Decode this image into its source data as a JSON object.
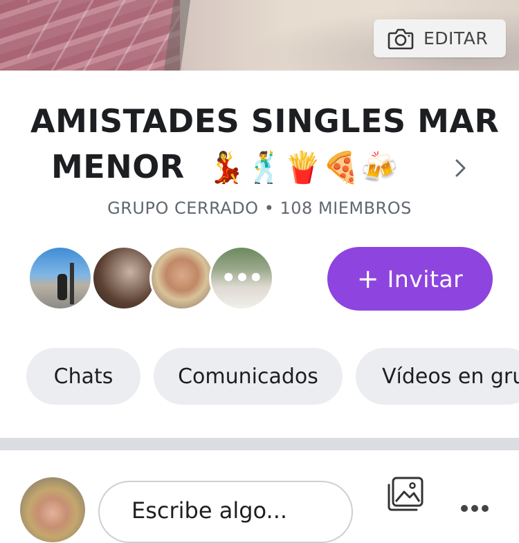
{
  "cover": {
    "edit_label": "EDITAR"
  },
  "group": {
    "title_line1": "AMISTADES   SINGLES MAR",
    "title_line2": "MENOR",
    "title_emojis": "💃🕺🍟🍕🍻",
    "subtitle": "GRUPO CERRADO • 108 MIEMBROS"
  },
  "members": {
    "more_indicator": "•••",
    "invite_label": "Invitar",
    "invite_plus": "+"
  },
  "tabs": [
    {
      "label": "Chats"
    },
    {
      "label": "Comunicados"
    },
    {
      "label": "Vídeos en grupo"
    }
  ],
  "composer": {
    "placeholder": "Escribe algo..."
  },
  "colors": {
    "accent": "#8e44df",
    "tab_bg": "#ebedf0",
    "divider": "#dadde1"
  },
  "icons": [
    "camera-icon",
    "chevron-right-icon",
    "photo-icon",
    "more-icon"
  ]
}
